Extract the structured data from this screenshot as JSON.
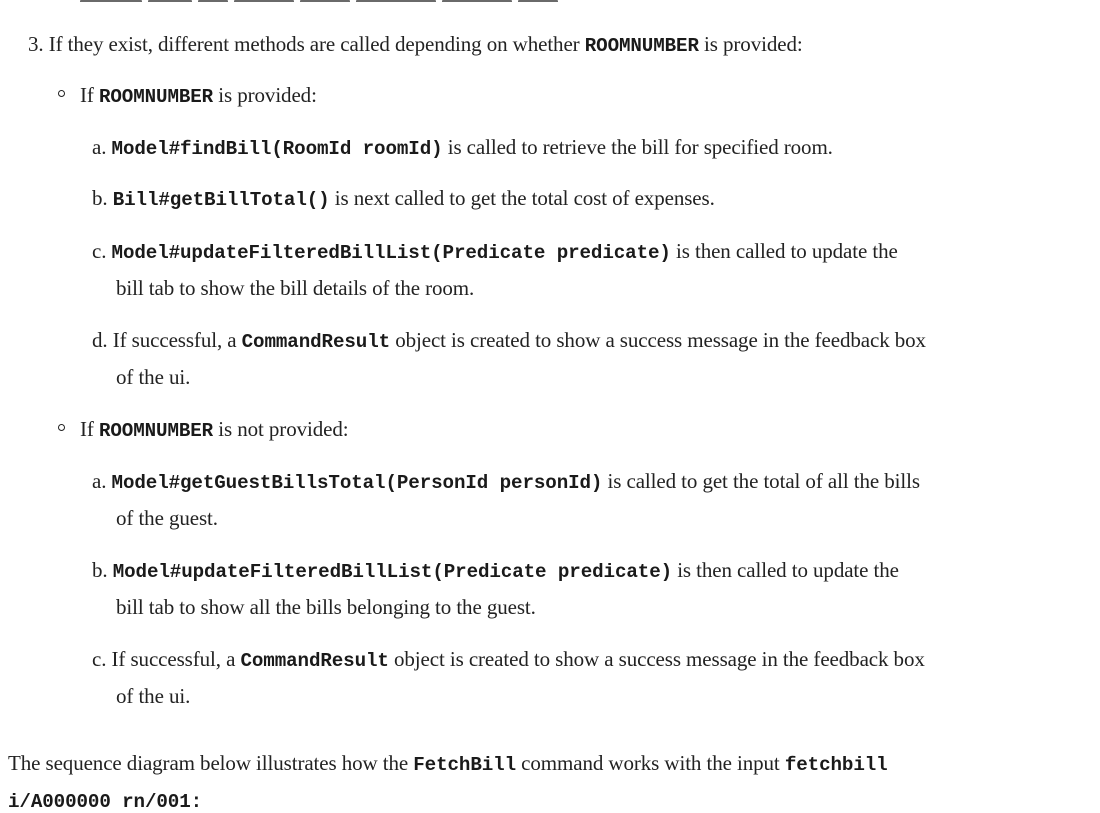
{
  "step3": {
    "marker": "3.",
    "text_before": "If they exist, different methods are called depending on whether",
    "code": "ROOMNUMBER",
    "text_after": "is provided:"
  },
  "room_provided": {
    "prefix": "If",
    "code": "ROOMNUMBER",
    "suffix": "is provided:",
    "items": [
      {
        "marker": "a.",
        "code": "Model#findBill(RoomId roomId)",
        "text_line1": "is called to retrieve the bill for specified room."
      },
      {
        "marker": "b.",
        "code": "Bill#getBillTotal()",
        "text_line1": "is next called to get the total cost of expenses."
      },
      {
        "marker": "c.",
        "code": "Model#updateFilteredBillList(Predicate predicate)",
        "text_line1": "is then called to update the",
        "text_line2": "bill tab to show the bill details of the room."
      },
      {
        "marker": "d.",
        "text_before": "If successful, a",
        "code": "CommandResult",
        "text_line1": "object is created to show a success message in the feedback box",
        "text_line2": "of the ui."
      }
    ]
  },
  "room_not_provided": {
    "prefix": "If",
    "code": "ROOMNUMBER",
    "suffix": "is not provided:",
    "items": [
      {
        "marker": "a.",
        "code": "Model#getGuestBillsTotal(PersonId personId)",
        "text_line1": "is called to get the total of all the bills",
        "text_line2": "of the guest."
      },
      {
        "marker": "b.",
        "code": "Model#updateFilteredBillList(Predicate predicate)",
        "text_line1": "is then called to update the",
        "text_line2": "bill tab to show all the bills belonging to the guest."
      },
      {
        "marker": "c.",
        "text_before": "If successful, a",
        "code": "CommandResult",
        "text_line1": "object is created to show a success message in the feedback box",
        "text_line2": "of the ui."
      }
    ]
  },
  "sequence_intro": {
    "text1": "The sequence diagram below illustrates how the",
    "code1": "FetchBill",
    "text2": "command works with the input",
    "code2_line1": "fetchbill",
    "code2_line2": "i/A000000 rn/001",
    "colon": ":"
  }
}
